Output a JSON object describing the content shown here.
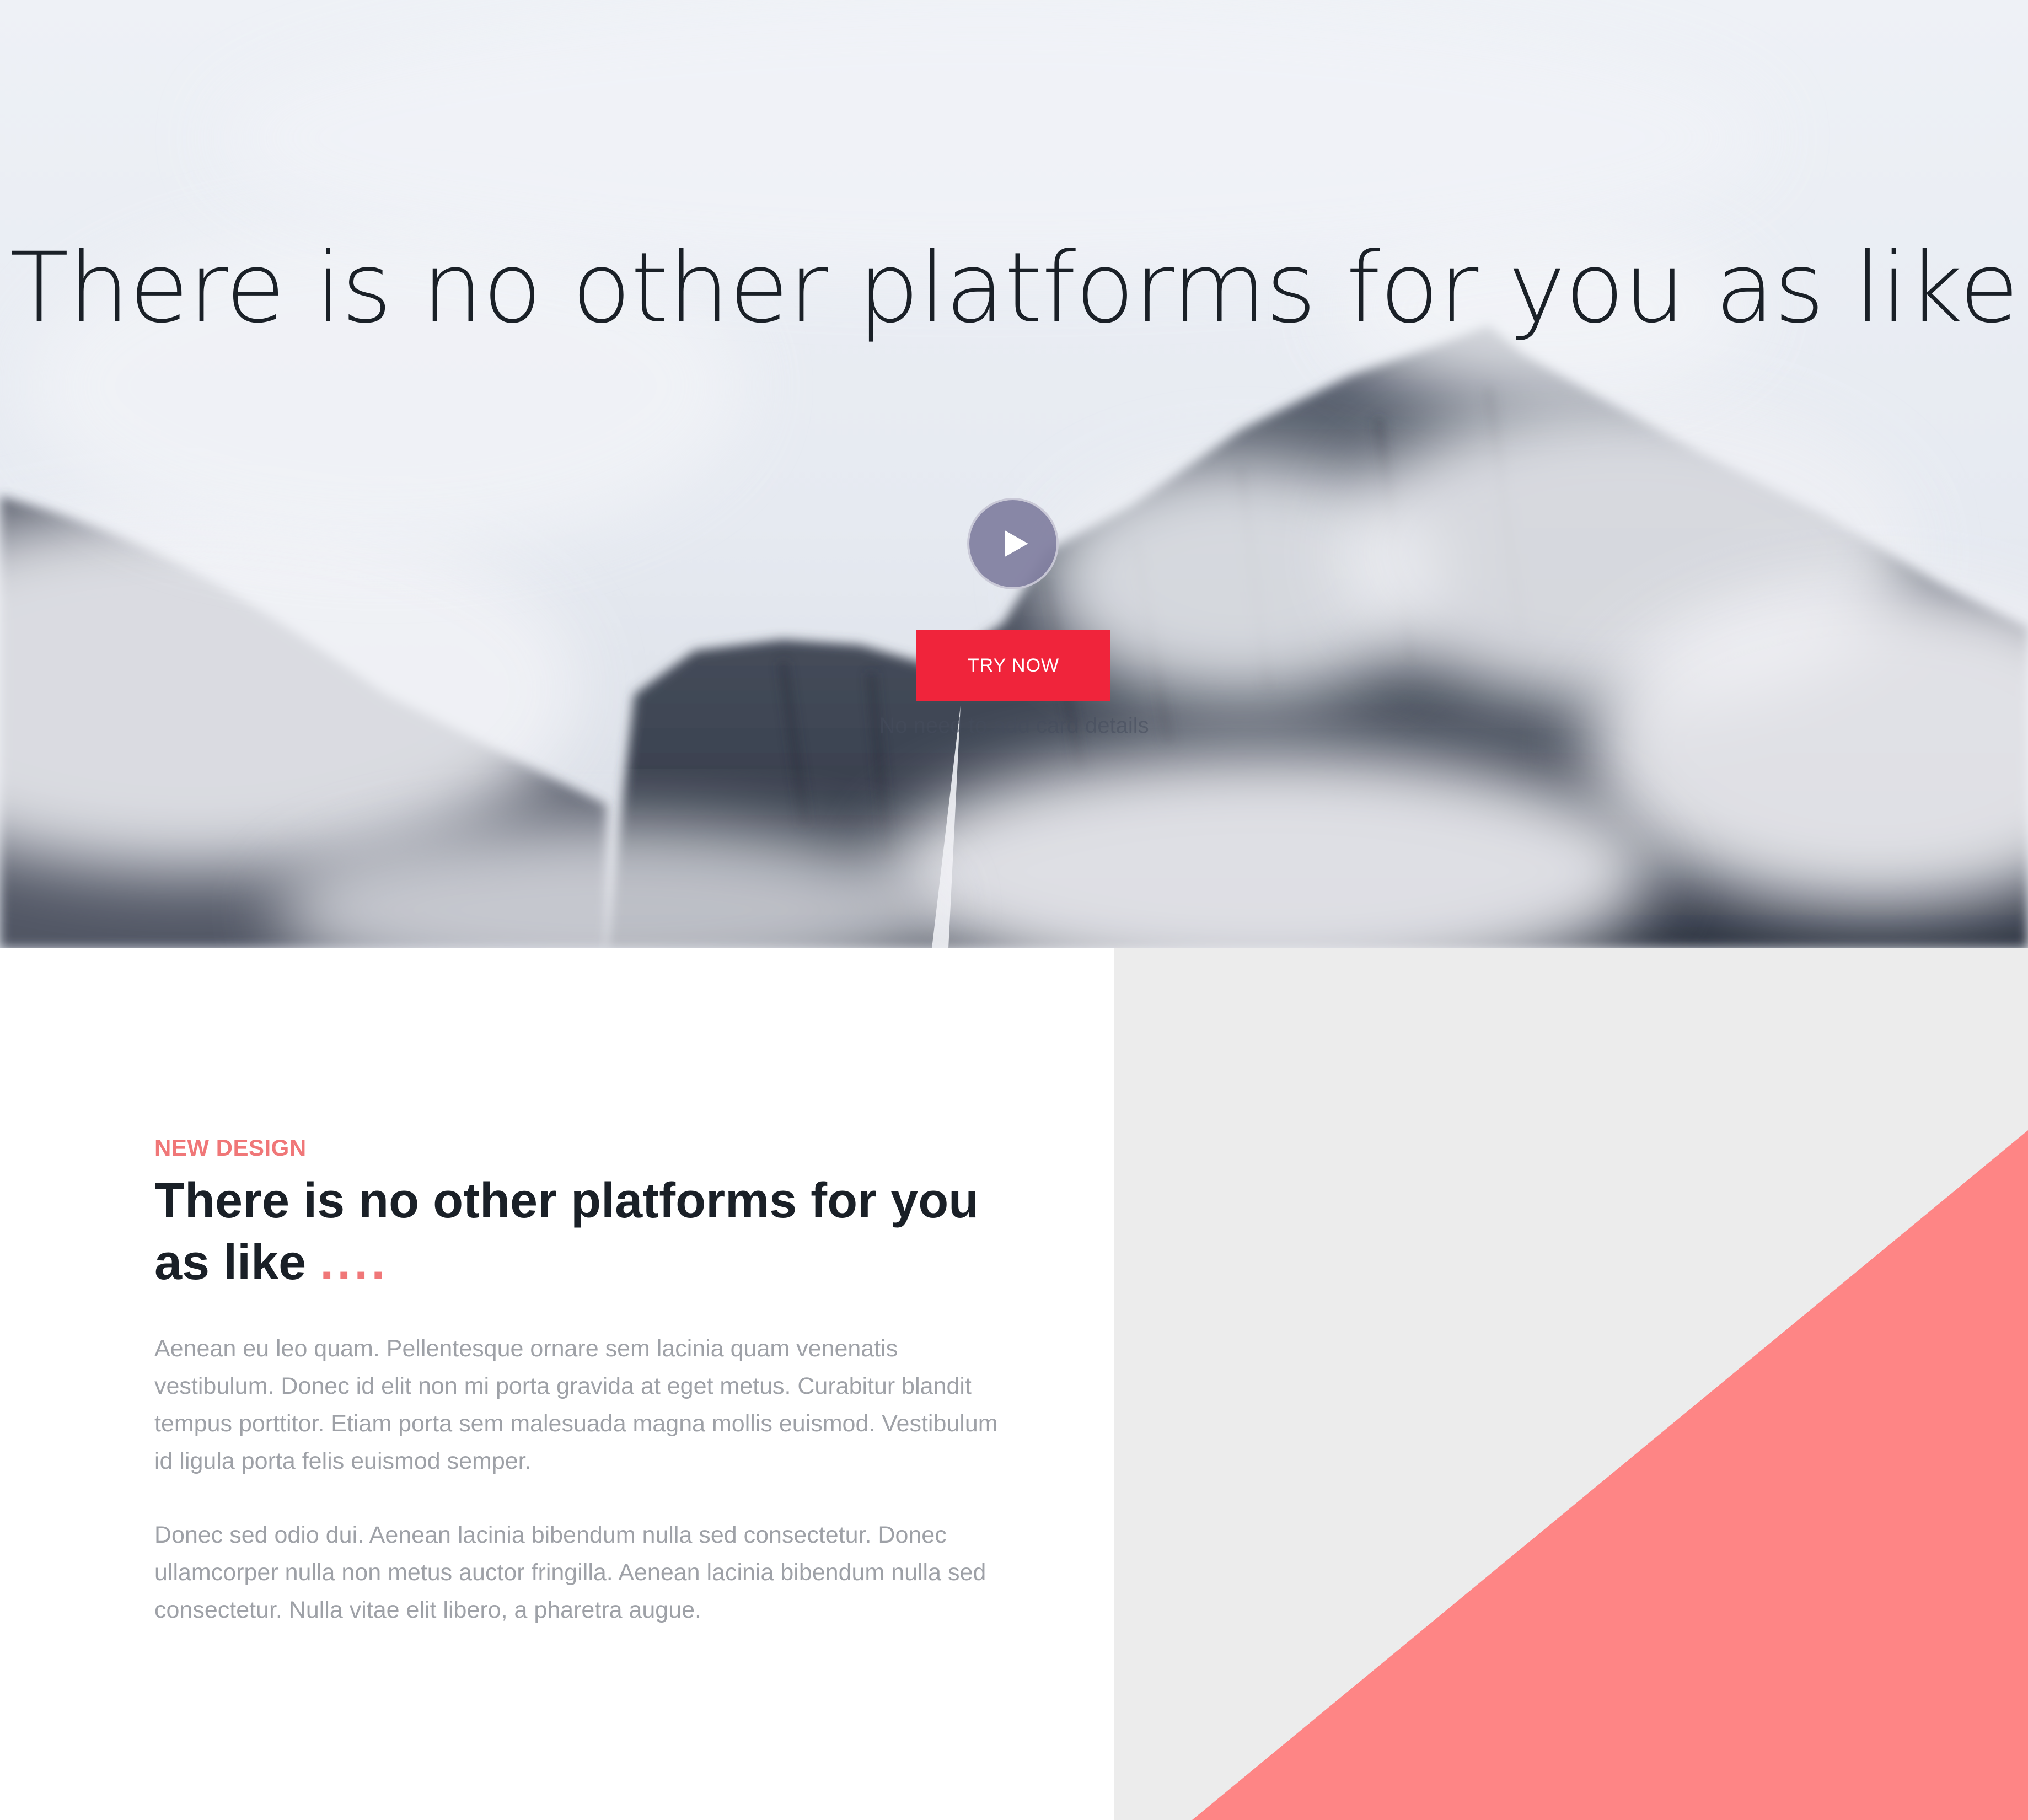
{
  "hero": {
    "title": "There is no other platforms for you as like",
    "play_icon": "play-icon",
    "cta_label": "TRY NOW",
    "note": "No need to add card details"
  },
  "feature": {
    "eyebrow": "NEW DESIGN",
    "title": "There is no other platforms for you as like",
    "title_suffix": "....",
    "paragraphs": [
      "Aenean eu leo quam. Pellentesque ornare sem lacinia quam venenatis vestibulum. Donec id elit non mi porta gravida at eget metus. Curabitur blandit tempus porttitor. Etiam porta sem malesuada magna mollis euismod. Vestibulum id ligula porta felis euismod semper.",
      "Donec sed odio dui. Aenean lacinia bibendum nulla sed consectetur. Donec ullamcorper nulla non metus auctor fringilla. Aenean lacinia bibendum nulla sed consectetur. Nulla vitae elit libero, a pharetra augue."
    ]
  },
  "colors": {
    "accent": "#f0243b",
    "coral": "#f07778",
    "shape_fill": "#fe8585",
    "panel_bg": "#ececec",
    "heading": "#1a2027",
    "body_text": "#9ea1a7"
  }
}
